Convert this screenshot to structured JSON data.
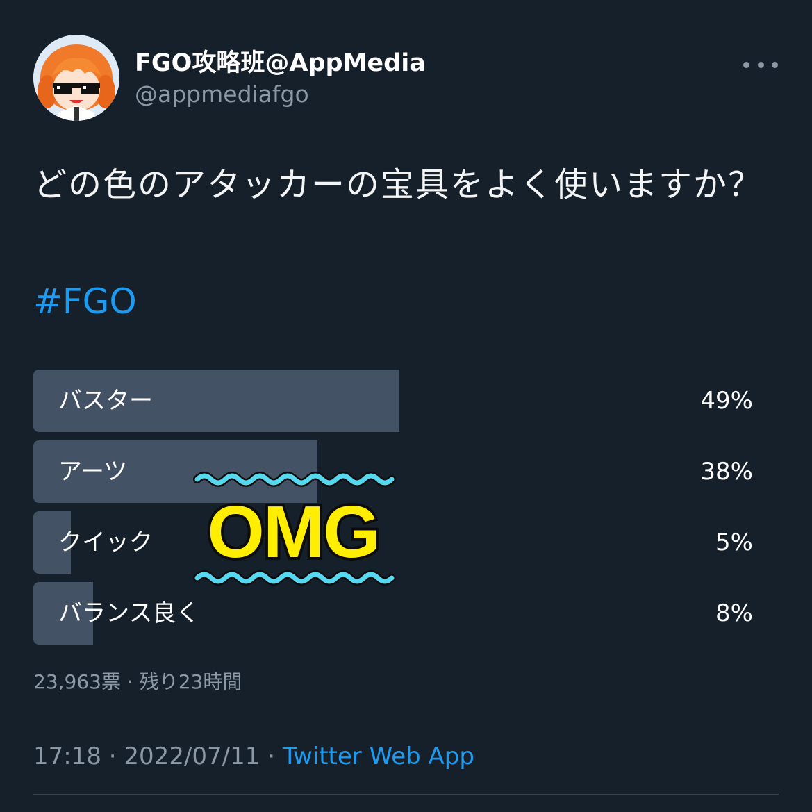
{
  "author": {
    "display_name": "FGO攻略班@AppMedia",
    "handle": "@appmediafgo",
    "avatar_icon": "avatar-anime-girl-sunglasses-icon"
  },
  "menu": {
    "icon": "more-horizontal-icon"
  },
  "tweet": {
    "text": "どの色のアタッカーの宝具をよく使いますか？",
    "hashtag": "#FGO"
  },
  "poll": {
    "options": [
      {
        "label": "バスター",
        "percent_label": "49%",
        "percent": 49
      },
      {
        "label": "アーツ",
        "percent_label": "38%",
        "percent": 38
      },
      {
        "label": "クイック",
        "percent_label": "5%",
        "percent": 5
      },
      {
        "label": "バランス良く",
        "percent_label": "8%",
        "percent": 8
      }
    ],
    "votes": "23,963票",
    "separator": " · ",
    "time_left": "残り23時間"
  },
  "meta": {
    "time": "17:18",
    "date": "2022/07/11",
    "separator": " · ",
    "source": "Twitter Web App"
  },
  "sticker": {
    "text": "OMG",
    "text_color": "#ffee00",
    "wave_color": "#55d8f0"
  },
  "colors": {
    "background": "#16202b",
    "poll_bar": "#435365",
    "link": "#1d9bf0",
    "secondary_text": "#8b98a5"
  }
}
